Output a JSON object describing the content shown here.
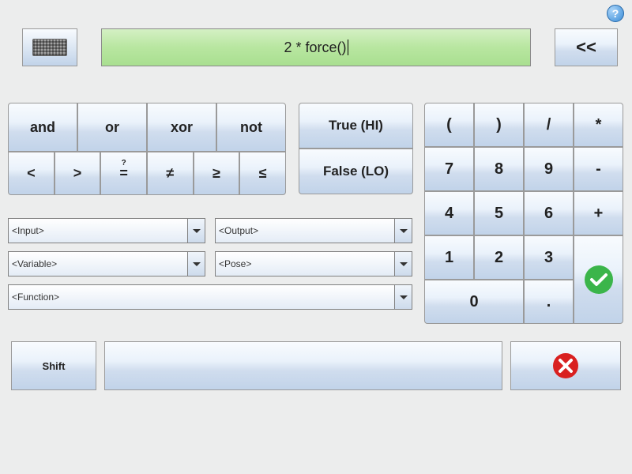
{
  "expression": "2 * force()",
  "back_label": "<<",
  "logic": {
    "and": "and",
    "or": "or",
    "xor": "xor",
    "not": "not",
    "lt": "<",
    "gt": ">",
    "eq": "=",
    "neq": "≠",
    "gte": "≥",
    "lte": "≤"
  },
  "bool": {
    "true": "True (HI)",
    "false": "False (LO)"
  },
  "numpad": {
    "lparen": "(",
    "rparen": ")",
    "div": "/",
    "mul": "*",
    "7": "7",
    "8": "8",
    "9": "9",
    "minus": "-",
    "4": "4",
    "5": "5",
    "6": "6",
    "plus": "+",
    "1": "1",
    "2": "2",
    "3": "3",
    "0": "0",
    "dot": "."
  },
  "dropdowns": {
    "input": "<Input>",
    "output": "<Output>",
    "variable": "<Variable>",
    "pose": "<Pose>",
    "function": "<Function>"
  },
  "shift": "Shift",
  "help": "?"
}
